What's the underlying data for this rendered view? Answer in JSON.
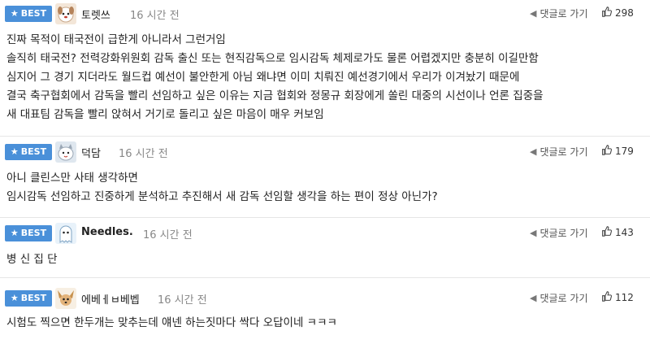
{
  "comments": [
    {
      "badge": "BEST",
      "nickname": "토렛쓰",
      "time": "16 시간 전",
      "reply_label": "댓글로 가기",
      "likes": "298",
      "avatar_icon": "dog-avatar-icon",
      "lines": [
        "진짜 목적이 태국전이 급한게 아니라서 그런거임",
        "솔직히 태국전? 전력강화위원회 감독 출신 또는 현직감독으로 임시감독 체제로가도 물론 어렵겠지만 충분히 이길만함",
        "심지어 그 경기 지더라도 월드컵 예선이 불안한게 아님 왜냐면 이미 치뤄진 예선경기에서 우리가 이겨놨기 때문에",
        "결국 축구협회에서 감독을 빨리 선임하고 싶은 이유는 지금 협회와 정몽규 회장에게 쏠린 대중의 시선이나 언론 집중을",
        "새 대표팀 감독을 빨리 앉혀서 거기로 돌리고 싶은 마음이 매우 커보임"
      ]
    },
    {
      "badge": "BEST",
      "nickname": "덕담",
      "time": "16 시간 전",
      "reply_label": "댓글로 가기",
      "likes": "179",
      "avatar_icon": "cat-avatar-icon",
      "lines": [
        "아니 클린스만 사태 생각하면",
        "임시감독 선임하고 진중하게 분석하고 추진해서 새 감독 선임할 생각을 하는 편이 정상 아닌가?"
      ]
    },
    {
      "badge": "BEST",
      "nickname": "Needles.",
      "time": "16 시간 전",
      "reply_label": "댓글로 가기",
      "likes": "143",
      "avatar_icon": "ghost-avatar-icon",
      "lines": [
        "병 신 집 단"
      ]
    },
    {
      "badge": "BEST",
      "nickname": "에베ㅔㅂ베벱",
      "time": "16 시간 전",
      "reply_label": "댓글로 가기",
      "likes": "112",
      "avatar_icon": "chihuahua-avatar-icon",
      "lines": [
        "시험도 찍으면 한두개는 맞추는데 얘넨 하는짓마다 싹다 오답이네 ㅋㅋㅋ"
      ]
    }
  ],
  "colors": {
    "badge_bg": "#4a90d9",
    "divider": "#e6e6e6",
    "time": "#888888"
  }
}
